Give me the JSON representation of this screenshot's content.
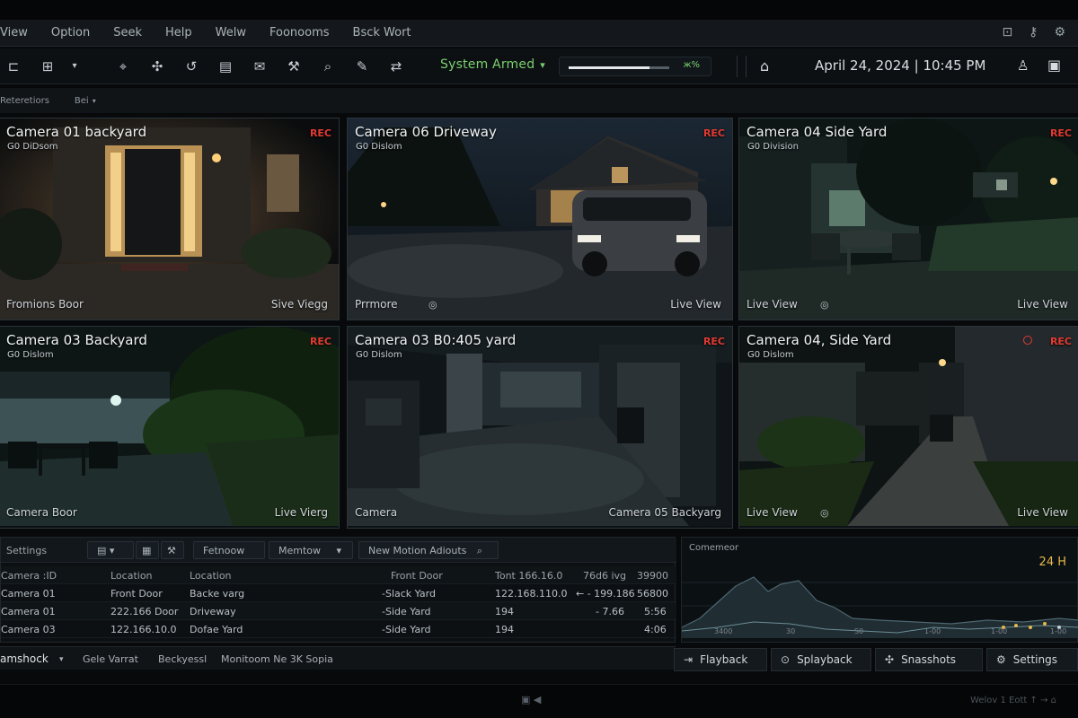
{
  "menu": {
    "items": [
      "View",
      "Option",
      "Seek",
      "Help",
      "Welw",
      "Foonooms",
      "Bsck Wort"
    ]
  },
  "toolbar": {
    "status": "System Armed",
    "volume_pct": 0.8,
    "volume_label": "ж%",
    "datetime": "April 24, 2024 | 10:45 PM"
  },
  "breadcrumb": {
    "left": "Reteretiors",
    "right": "Bei"
  },
  "cameras": [
    {
      "title": "Camera 01 backyard",
      "sub": "Ǥ0 DiDsom",
      "rec": "REC",
      "bl": "Fromions  Boor",
      "br": "Sive Viegg"
    },
    {
      "title": "Camera 06 Driveway",
      "sub": "Ǥ0 Dislom",
      "rec": "REC",
      "bl": "Prrmore",
      "br": "Live View"
    },
    {
      "title": "Camera 04  Side Yard",
      "sub": "Ǥ0 Division",
      "rec": "REC",
      "bl": "Live View",
      "br": "Live View"
    },
    {
      "title": "Camera 03  Backyard",
      "sub": "Ǥ0 Dislom",
      "rec": "REC",
      "bl": "Camera  Boor",
      "br": "Live Vierg"
    },
    {
      "title": "Camera 03  B0:405 yard",
      "sub": "Ǥ0 Dislom",
      "rec": "REC",
      "bl": "Camera",
      "br": "Camera 05 Backyarg"
    },
    {
      "title": "Camera 04, Side Yard",
      "sub": "Ǥ0 Dislom",
      "rec": "REC",
      "bl": "Live View",
      "br": "Live View"
    }
  ],
  "events": {
    "tabs": [
      "Settings",
      "Fetnoow",
      "Memtow",
      "New Motion Adiouts"
    ],
    "head": [
      "Camera :ID",
      "Location",
      "Location",
      "Front Door",
      "Tont 166.16.0",
      "76d6 ivg",
      "39900"
    ],
    "rows": [
      [
        "Camera 01",
        "Front Door",
        "Backe varg",
        "-Slack Yard",
        "122.168.110.0",
        "← - 199.186",
        "56800"
      ],
      [
        "Camera 01",
        "222.166 Door",
        "Driveway",
        "-Side Yard",
        "194",
        "- 7.66",
        "5:56"
      ],
      [
        "Camera 03",
        "122.166.10.0",
        "Dofae Yard",
        "-Side Yard",
        "194",
        "",
        "4:06"
      ]
    ]
  },
  "bottom_tabs": [
    "amshock",
    "Gele Varrat",
    "Beckyessl",
    "Monitoom Ne 3K Sopia"
  ],
  "motion": {
    "title": "Comemeor",
    "range": "24 H",
    "ticks": [
      "3400",
      "30",
      "S0",
      "1-00",
      "1-00",
      "1-00"
    ]
  },
  "actions": [
    "Flayback",
    "Splayback",
    "Snasshots",
    "Settings"
  ],
  "footer": {
    "right": "Welov   1 Eott  ↑ → ⌂"
  }
}
